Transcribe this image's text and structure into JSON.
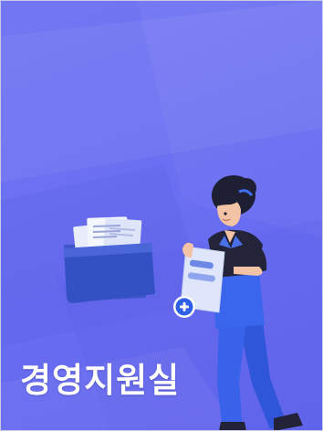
{
  "card": {
    "title": "경영지원실",
    "background_color": "#6a6ef1",
    "accent_color": "#2f5fe6"
  },
  "illustration": {
    "folder_icon": "folder-with-documents-icon",
    "person": "woman-holding-document",
    "add_icon": "plus-circle-icon"
  }
}
